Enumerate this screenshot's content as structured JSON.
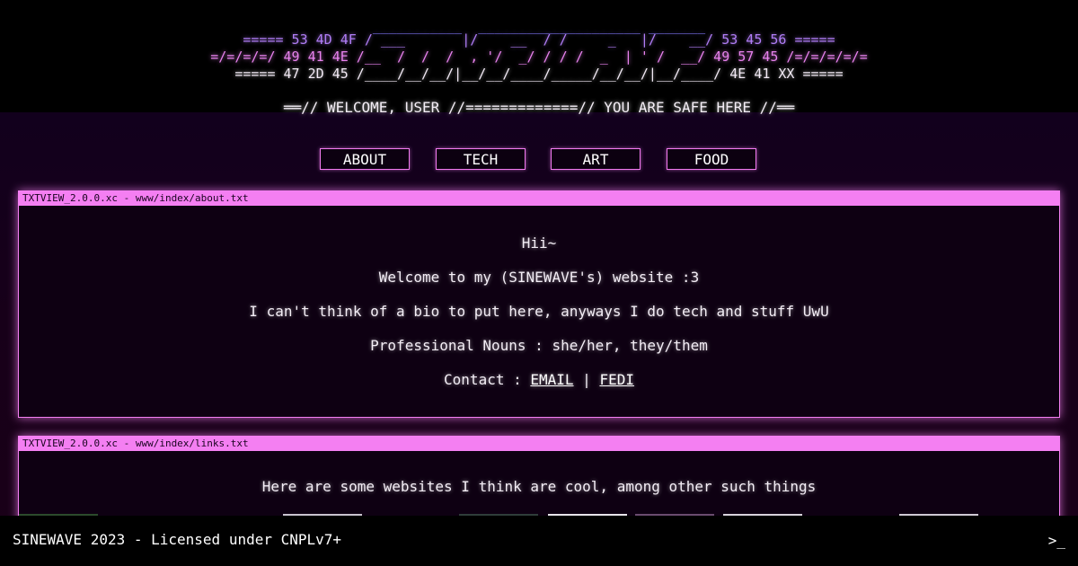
{
  "banner": {
    "line0": "___________  ____________________ _______",
    "line1": "===== 53 4D 4F / ___       |/    __  / /     _   |/    __/ 53 45 56 =====",
    "line2": "=/=/=/=/ 49 41 4E /__  /  /  /  , '/  _/ / / /  _  | ' /  __/ 49 57 45 /=/=/=/=/=",
    "line3": "===== 47 2D 45 /____/__/__/|__/__/____/_____/__/__/|__/____/ 4E 41 XX =====",
    "welcome": "══// WELCOME, USER //=============// YOU ARE SAFE HERE //══"
  },
  "nav": {
    "about": "ABOUT",
    "tech": "TECH",
    "art": "ART",
    "food": "FOOD"
  },
  "about_window": {
    "title": "TXTVIEW_2.0.0.xc - www/index/about.txt",
    "greeting": "Hii~",
    "welcome": "Welcome to my (SINEWAVE's) website :3",
    "bio": "I can't think of a bio to put here, anyways I do tech and stuff UwU",
    "nouns": "Professional Nouns : she/her, they/them",
    "contact_label": "Contact : ",
    "email_link": "EMAIL",
    "separator": " | ",
    "fedi_link": "FEDI"
  },
  "links_window": {
    "title": "TXTVIEW_2.0.0.xc - www/index/links.txt",
    "intro": "Here are some websites I think are cool, among other such things"
  },
  "footer": {
    "text": "SINEWAVE 2023 - Licensed under CNPLv7+",
    "prompt": ">_"
  },
  "colors": {
    "accent": "#f47ff2",
    "background": "#000000",
    "panel": "#0e0012"
  }
}
